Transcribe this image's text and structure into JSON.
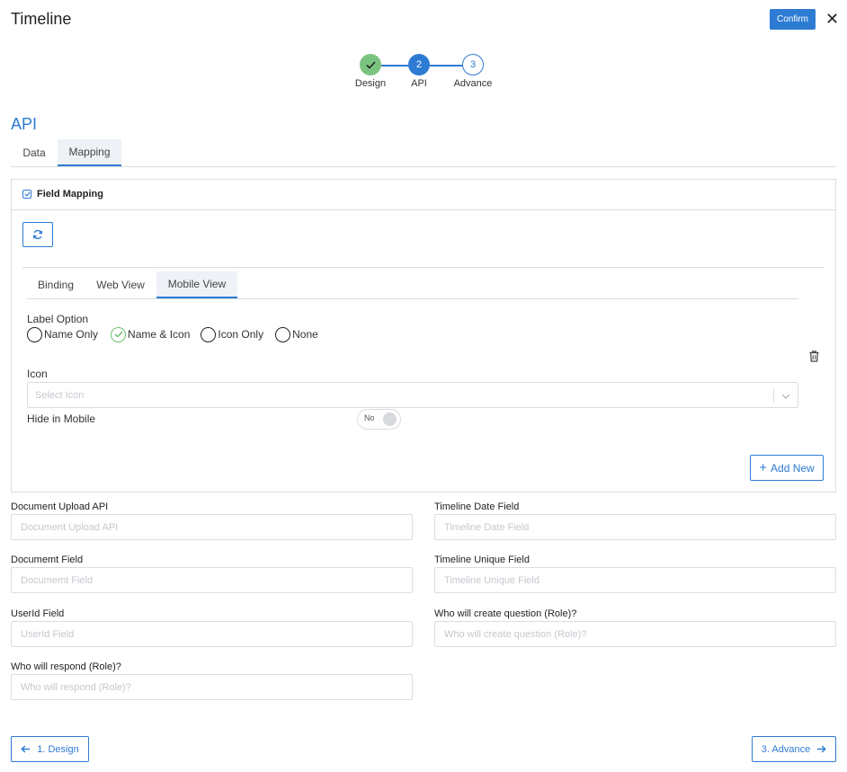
{
  "header": {
    "title": "Timeline",
    "confirm_label": "Confirm",
    "close_glyph": "✕"
  },
  "stepper": {
    "steps": [
      {
        "number": "1",
        "label": "Design",
        "state": "done"
      },
      {
        "number": "2",
        "label": "API",
        "state": "active"
      },
      {
        "number": "3",
        "label": "Advance",
        "state": "todo"
      }
    ]
  },
  "section": {
    "title": "API"
  },
  "main_tabs": [
    {
      "label": "Data",
      "active": false
    },
    {
      "label": "Mapping",
      "active": true
    }
  ],
  "field_mapping": {
    "title": "Field Mapping",
    "checked": true,
    "sub_tabs": [
      {
        "label": "Binding",
        "active": false
      },
      {
        "label": "Web View",
        "active": false
      },
      {
        "label": "Mobile View",
        "active": true
      }
    ],
    "label_option": {
      "label": "Label Option",
      "options": [
        "Name Only",
        "Name & Icon",
        "Icon Only",
        "None"
      ],
      "selected": "Name & Icon"
    },
    "icon": {
      "label": "Icon",
      "placeholder": "Select Icon"
    },
    "hide_in_mobile": {
      "label": "Hide in Mobile",
      "toggle_text": "No",
      "value": false
    },
    "add_new_label": "Add New"
  },
  "fields": {
    "document_upload_api": {
      "label": "Document Upload API",
      "placeholder": "Document Upload API"
    },
    "timeline_date_field": {
      "label": "Timeline Date Field",
      "placeholder": "Timeline Date Field"
    },
    "document_field": {
      "label": "Documemt Field",
      "placeholder": "Documemt Field"
    },
    "timeline_unique_field": {
      "label": "Timeline Unique Field",
      "placeholder": "Timeline Unique Field"
    },
    "userid_field": {
      "label": "UserId Field",
      "placeholder": "UserId Field"
    },
    "who_create_question": {
      "label": "Who will create question (Role)?",
      "placeholder": "Who will create question (Role)?"
    },
    "who_respond": {
      "label": "Who will respond (Role)?",
      "placeholder": "Who will respond (Role)?"
    }
  },
  "footer": {
    "prev_label": "1. Design",
    "next_label": "3. Advance"
  },
  "colors": {
    "accent": "#2d7bd3",
    "success": "#7bc47f",
    "border": "#d9dde3"
  }
}
